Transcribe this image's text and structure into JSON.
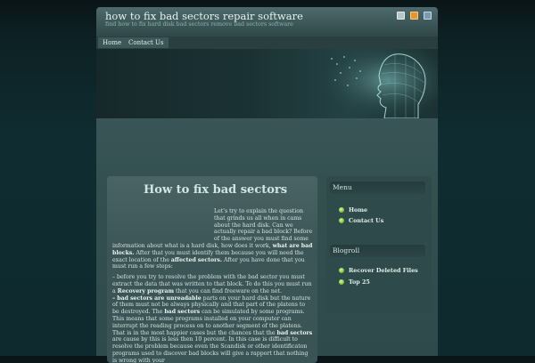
{
  "header": {
    "title": "how to fix bad sectors repair software",
    "tagline": "find how to fix hard disk bad sectors remove bad sectors software",
    "icons": [
      "bookmark-icon",
      "rss-icon",
      "email-icon"
    ]
  },
  "nav": {
    "items": [
      "Home",
      "Contact Us"
    ]
  },
  "post": {
    "title": "How to fix bad sectors",
    "p1": "Let's try to explain the question that grinds us all when in cams about the hard disk. Can we actually repair a bad block? Before of the answer you must find some information about what is a hard disk, how does it work,",
    "p1_bold": "what are bad blocks.",
    "p1_cont": "After that you must identify them because you will need the exact location of the",
    "p1_bold2": "affected sectors.",
    "p1_end": "After you have done that you must run a few steps:",
    "p2": "– before you try to resolve the problem with the bad sector you must extract the data that was written to that block. To do this you must run a",
    "p2_bold": "Recovery program",
    "p2_end": "that you can find freeware on the net.",
    "p3_bold": "– bad sectors are unreadable",
    "p3": "parts on your hard disk but the nature of them must not be always physically and that part of the platens to be destroyed. The",
    "p3_bold2": "bad sectors",
    "p3_cont": "can be simulated by some programs. This means that some programs installed on your computer can interrupt the reading process on to another segment of the platens. That is in the most happier cases but the chances that the",
    "p3_bold3": "bad sectors",
    "p3_end": "are cause by this is less then 10 percent. In this case is difficult to resolve the problem because even the Scandisk or other identificaton programs used to discover bad blocks will give a rapport that nothing is wrong with your"
  },
  "sidebar": {
    "menu_title": "Menu",
    "menu_items": [
      "Home",
      "Contact Us"
    ],
    "blogroll_title": "Blogroll",
    "blogroll_items": [
      "Recover Deleted Files",
      "Top 25"
    ]
  },
  "colors": {
    "accent_green": "#8fd04a",
    "background": "#0f2c30"
  }
}
